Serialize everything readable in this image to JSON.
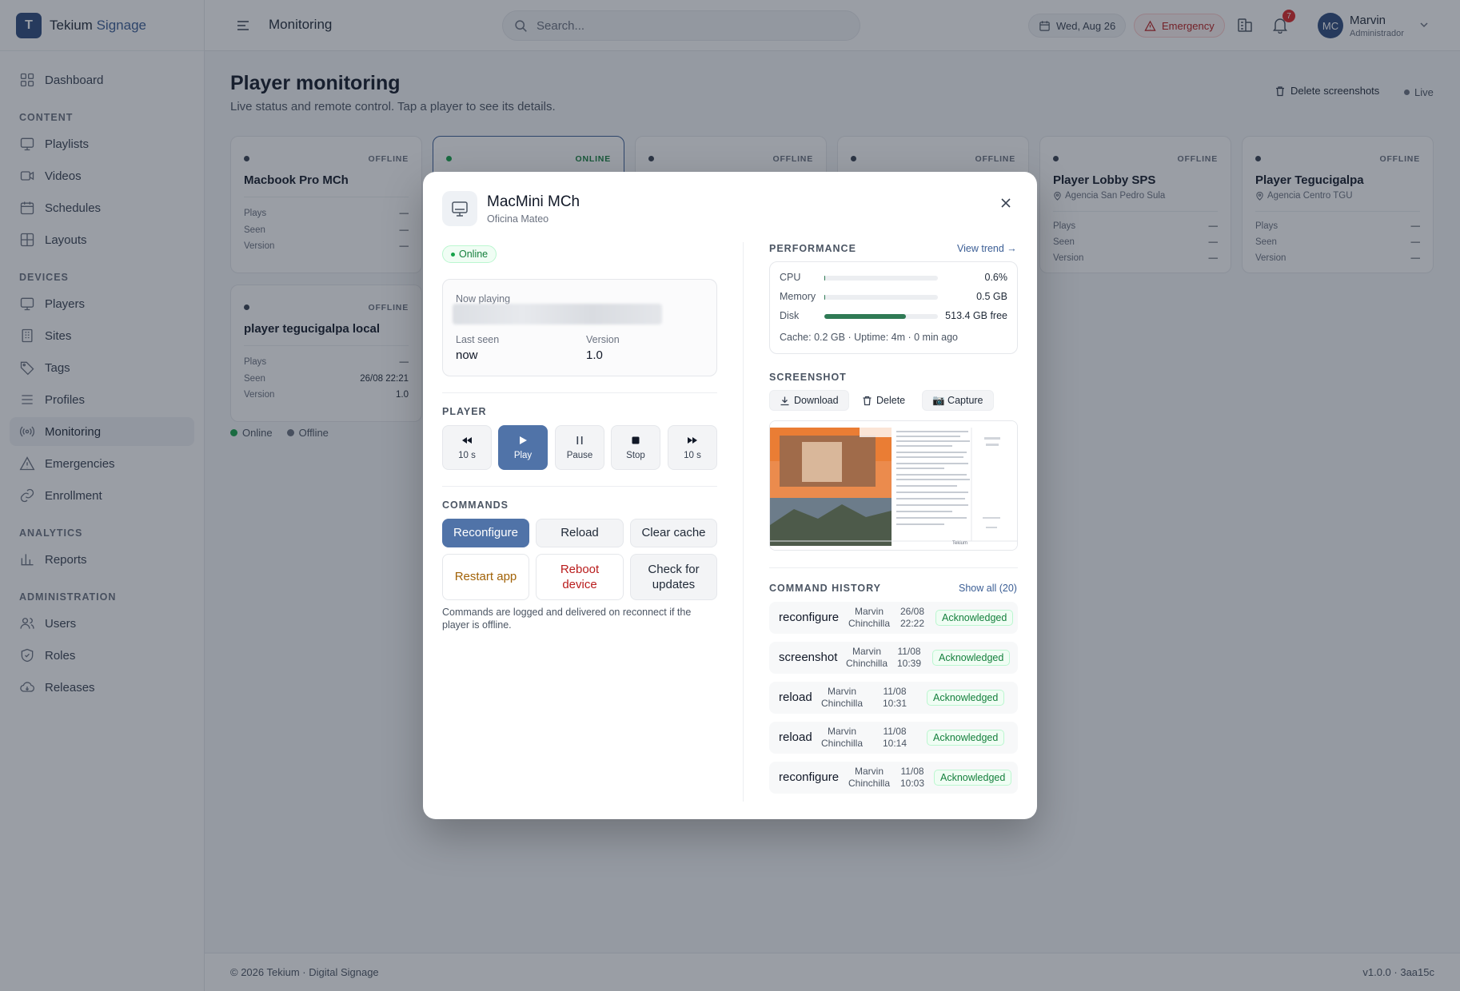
{
  "app": {
    "logo_letter": "T",
    "name_main": "Tekium",
    "name_accent": "Signage"
  },
  "sidebar": {
    "items": [
      {
        "label": "Dashboard",
        "icon": "dashboard-icon"
      },
      {
        "section": "CONTENT"
      },
      {
        "label": "Playlists",
        "icon": "playlist-icon"
      },
      {
        "label": "Videos",
        "icon": "video-icon"
      },
      {
        "label": "Schedules",
        "icon": "calendar-icon"
      },
      {
        "label": "Layouts",
        "icon": "layout-icon"
      },
      {
        "section": "DEVICES"
      },
      {
        "label": "Players",
        "icon": "monitor-icon"
      },
      {
        "label": "Sites",
        "icon": "building-icon"
      },
      {
        "label": "Tags",
        "icon": "tag-icon"
      },
      {
        "label": "Profiles",
        "icon": "list-icon"
      },
      {
        "label": "Monitoring",
        "icon": "radio-icon",
        "active": true
      },
      {
        "label": "Emergencies",
        "icon": "warning-icon"
      },
      {
        "label": "Enrollment",
        "icon": "link-icon"
      },
      {
        "section": "ANALYTICS"
      },
      {
        "label": "Reports",
        "icon": "bar-chart-icon"
      },
      {
        "section": "ADMINISTRATION"
      },
      {
        "label": "Users",
        "icon": "users-icon"
      },
      {
        "label": "Roles",
        "icon": "shield-icon"
      },
      {
        "label": "Releases",
        "icon": "cloud-icon"
      }
    ]
  },
  "header": {
    "title": "Monitoring",
    "search_placeholder": "Search...",
    "date": "Wed, Aug 26",
    "emergency_label": "Emergency",
    "notification_count": "7",
    "user_initials": "MC",
    "user_name": "Marvin",
    "user_role": "Administrador"
  },
  "main": {
    "title": "Player monitoring",
    "subtitle": "Live status and remote control. Tap a player to see its details.",
    "delete_screenshots_label": "Delete screenshots",
    "live_label": "Live",
    "row_labels": {
      "plays": "Plays",
      "seen": "Seen",
      "version": "Version"
    },
    "players": [
      {
        "name": "Macbook Pro MCh",
        "status": "OFFLINE",
        "location": "",
        "plays": "—",
        "seen": "—",
        "version": "—"
      },
      {
        "name": "MacMini MCh",
        "status": "ONLINE",
        "location": "",
        "plays": "",
        "seen": "",
        "version": ""
      },
      {
        "name": "",
        "status": "OFFLINE",
        "location": "",
        "plays": "",
        "seen": "",
        "version": ""
      },
      {
        "name": "",
        "status": "OFFLINE",
        "location": "",
        "plays": "",
        "seen": "",
        "version": ""
      },
      {
        "name": "Player Lobby SPS",
        "status": "OFFLINE",
        "location": "Agencia San Pedro Sula",
        "plays": "—",
        "seen": "—",
        "version": "—"
      },
      {
        "name": "Player Tegucigalpa",
        "status": "OFFLINE",
        "location": "Agencia Centro TGU",
        "plays": "—",
        "seen": "—",
        "version": "—"
      },
      {
        "name": "player tegucigalpa local",
        "status": "OFFLINE",
        "location": "",
        "plays": "—",
        "seen": "26/08 22:21",
        "version": "1.0"
      }
    ],
    "legend": {
      "online": "Online",
      "offline": "Offline"
    }
  },
  "footer": {
    "copyright": "© 2026 Tekium · Digital Signage",
    "version": "v1.0.0 · 3aa15c"
  },
  "modal": {
    "title": "MacMini MCh",
    "subtitle": "Oficina Mateo",
    "status": "Online",
    "now_playing_label": "Now playing",
    "last_seen_label": "Last seen",
    "last_seen_value": "now",
    "version_label": "Version",
    "version_value": "1.0",
    "player_section": "PLAYER",
    "player_controls": [
      {
        "label": "10 s",
        "icon": "rewind-icon"
      },
      {
        "label": "Play",
        "icon": "play-icon"
      },
      {
        "label": "Pause",
        "icon": "pause-icon"
      },
      {
        "label": "Stop",
        "icon": "stop-icon"
      },
      {
        "label": "10 s",
        "icon": "fast-forward-icon"
      }
    ],
    "commands_section": "COMMANDS",
    "commands": [
      "Reconfigure",
      "Reload",
      "Clear cache",
      "Restart app",
      "Reboot device",
      "Check for updates"
    ],
    "commands_note": "Commands are logged and delivered on reconnect if the player is offline.",
    "performance_section": "PERFORMANCE",
    "view_trend": "View trend →",
    "performance": [
      {
        "label": "CPU",
        "value": "0.6%",
        "fraction": 0.006
      },
      {
        "label": "Memory",
        "value": "0.5 GB",
        "fraction": 0.01
      },
      {
        "label": "Disk",
        "value": "513.4 GB free",
        "fraction": 0.72
      }
    ],
    "performance_meta": "Cache: 0.2 GB · Uptime: 4m · 0 min ago",
    "screenshot_section": "SCREENSHOT",
    "screenshot_buttons": [
      "Download",
      "Delete",
      "📷 Capture"
    ],
    "screenshot_caption": "Tekium",
    "history_section": "COMMAND HISTORY",
    "show_all": "Show all (20)",
    "history": [
      {
        "command": "reconfigure",
        "by_first": "Marvin",
        "by_last": "Chinchilla",
        "date": "26/08",
        "time": "22:22",
        "status": "Acknowledged"
      },
      {
        "command": "screenshot",
        "by_first": "Marvin",
        "by_last": "Chinchilla",
        "date": "11/08",
        "time": "10:39",
        "status": "Acknowledged"
      },
      {
        "command": "reload",
        "by_first": "Marvin",
        "by_last": "Chinchilla",
        "date": "11/08",
        "time": "10:31",
        "status": "Acknowledged"
      },
      {
        "command": "reload",
        "by_first": "Marvin",
        "by_last": "Chinchilla",
        "date": "11/08",
        "time": "10:14",
        "status": "Acknowledged"
      },
      {
        "command": "reconfigure",
        "by_first": "Marvin",
        "by_last": "Chinchilla",
        "date": "11/08",
        "time": "10:03",
        "status": "Acknowledged"
      }
    ]
  },
  "colors": {
    "accent": "#5073a8",
    "brand": "#2c4a7c",
    "online": "#16a34a",
    "danger": "#b91c1c",
    "disk_bar": "#2f7a55"
  }
}
